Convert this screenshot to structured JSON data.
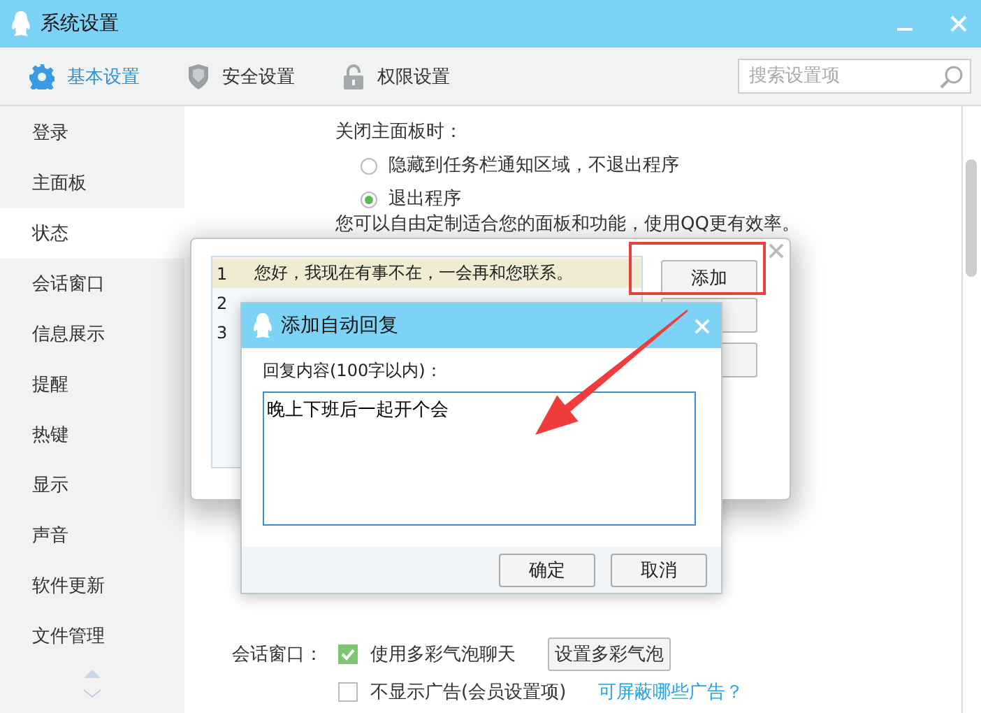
{
  "window": {
    "title": "系统设置"
  },
  "tabs": [
    {
      "label": "基本设置",
      "selected": true
    },
    {
      "label": "安全设置",
      "selected": false
    },
    {
      "label": "权限设置",
      "selected": false
    }
  ],
  "search": {
    "placeholder": "搜索设置项"
  },
  "sidebar": {
    "items": [
      {
        "label": "登录",
        "selected": false
      },
      {
        "label": "主面板",
        "selected": false
      },
      {
        "label": "状态",
        "selected": true
      },
      {
        "label": "会话窗口",
        "selected": false
      },
      {
        "label": "信息展示",
        "selected": false
      },
      {
        "label": "提醒",
        "selected": false
      },
      {
        "label": "热键",
        "selected": false
      },
      {
        "label": "显示",
        "selected": false
      },
      {
        "label": "声音",
        "selected": false
      },
      {
        "label": "软件更新",
        "selected": false
      },
      {
        "label": "文件管理",
        "selected": false
      }
    ]
  },
  "close_panel": {
    "label": "关闭主面板时：",
    "options": [
      {
        "label": "隐藏到任务栏通知区域，不退出程序",
        "selected": false
      },
      {
        "label": "退出程序",
        "selected": true
      }
    ]
  },
  "panel_note": "您可以自由定制适合您的面板和功能，使用QQ更有效率。",
  "chat_window": {
    "label": "会话窗口：",
    "options": [
      {
        "label": "使用多彩气泡聊天",
        "checked": true
      },
      {
        "label": "不显示广告(会员设置项)",
        "checked": false
      }
    ],
    "button": "设置多彩气泡",
    "link": "可屏蔽哪些广告？"
  },
  "auto_reply_dialog": {
    "rows": [
      {
        "number": "1",
        "text": "您好，我现在有事不在，一会再和您联系。",
        "selected": true
      },
      {
        "number": "2",
        "selected": false
      },
      {
        "number": "3",
        "selected": false
      }
    ],
    "buttons": [
      "添加"
    ]
  },
  "add_dialog": {
    "title": "添加自动回复",
    "label": "回复内容(100字以内)：",
    "value": "晚上下班后一起开个会",
    "buttons": [
      "确定",
      "取消"
    ]
  }
}
